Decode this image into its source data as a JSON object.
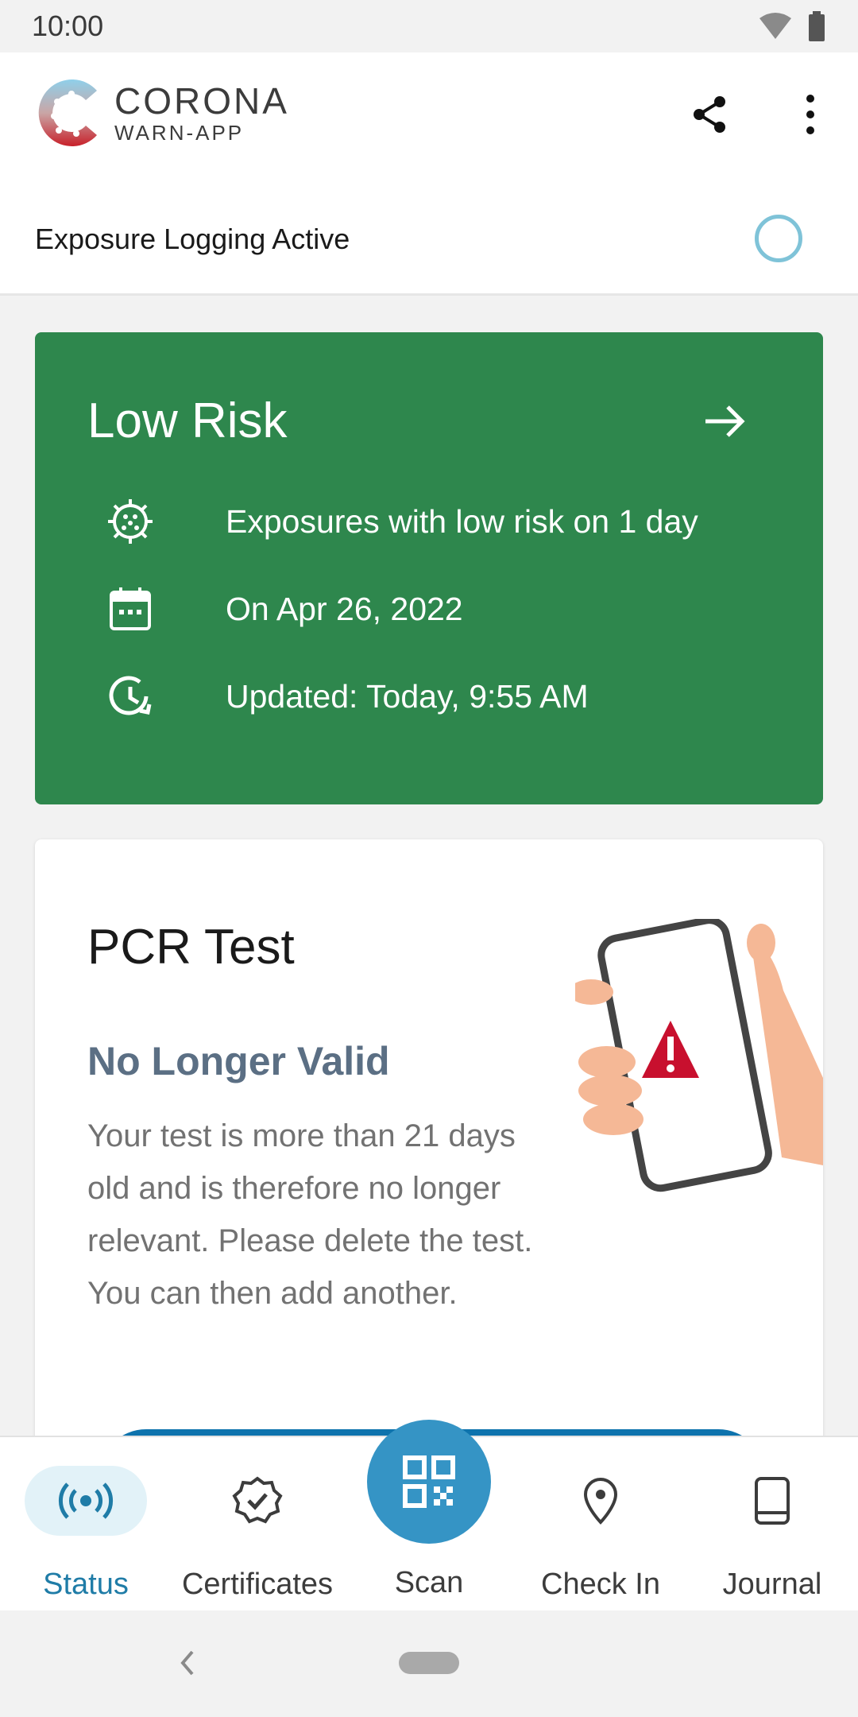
{
  "status_bar": {
    "time": "10:00"
  },
  "app_header": {
    "logo_title": "CORONA",
    "logo_subtitle": "WARN-APP"
  },
  "tracing": {
    "label": "Exposure Logging Active"
  },
  "risk_card": {
    "title": "Low Risk",
    "color": "#2e874d",
    "rows": [
      {
        "icon": "virus-icon",
        "text": "Exposures with low risk on 1 day"
      },
      {
        "icon": "calendar-icon",
        "text": "On Apr 26, 2022"
      },
      {
        "icon": "clock-refresh-icon",
        "text": "Updated: Today, 9:55 AM"
      }
    ]
  },
  "pcr_card": {
    "title": "PCR Test",
    "subtitle": "No Longer Valid",
    "body": "Your test is more than 21 days old and is therefore no longer relevant. Please delete the test. You can then add another."
  },
  "bottom_nav": {
    "items": [
      {
        "label": "Status",
        "icon": "radio-waves-icon",
        "active": true
      },
      {
        "label": "Certificates",
        "icon": "badge-check-icon",
        "active": false
      },
      {
        "label": "Scan",
        "icon": "qr-code-icon",
        "active": false
      },
      {
        "label": "Check In",
        "icon": "location-pin-icon",
        "active": false
      },
      {
        "label": "Journal",
        "icon": "book-icon",
        "active": false
      }
    ]
  },
  "colors": {
    "accent": "#1f7ca7",
    "risk_low": "#2e874d",
    "scan": "#3594c5",
    "button": "#0e73ad"
  }
}
